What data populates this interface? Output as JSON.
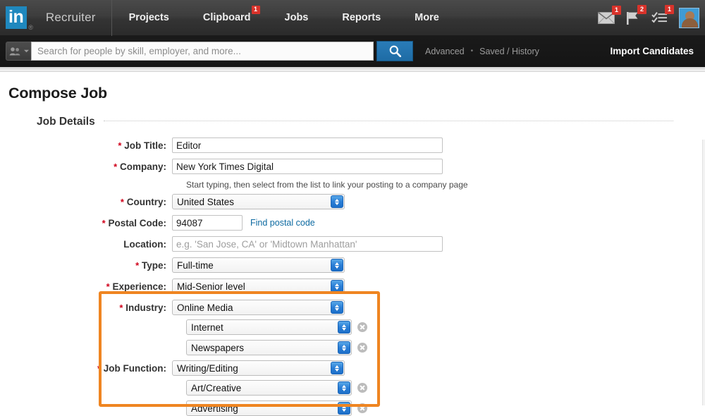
{
  "topnav": {
    "logo_text": "in",
    "logo_registered": "®",
    "brand": "Recruiter",
    "items": [
      {
        "label": "Projects",
        "badge": ""
      },
      {
        "label": "Clipboard",
        "badge": "1"
      },
      {
        "label": "Jobs",
        "badge": ""
      },
      {
        "label": "Reports",
        "badge": ""
      },
      {
        "label": "More",
        "badge": ""
      }
    ],
    "icons": [
      {
        "name": "messages-icon",
        "badge": "1"
      },
      {
        "name": "flag-icon",
        "badge": "2"
      },
      {
        "name": "tasks-icon",
        "badge": "1"
      }
    ]
  },
  "search": {
    "placeholder": "Search for people by skill, employer, and more...",
    "value": "",
    "advanced_label": "Advanced",
    "separator": "•",
    "saved_history_label": "Saved / History",
    "import_candidates_label": "Import Candidates"
  },
  "page": {
    "title": "Compose Job",
    "section_title": "Job Details"
  },
  "form": {
    "job_title": {
      "label": "Job Title:",
      "required": true,
      "value": "Editor"
    },
    "company": {
      "label": "Company:",
      "required": true,
      "value": "New York Times Digital",
      "help": "Start typing, then select from the list to link your posting to a company page"
    },
    "country": {
      "label": "Country:",
      "required": true,
      "value": "United States"
    },
    "postal_code": {
      "label": "Postal Code:",
      "required": true,
      "value": "94087",
      "link_label": "Find postal code"
    },
    "location": {
      "label": "Location:",
      "required": false,
      "value": "",
      "placeholder": "e.g. 'San Jose, CA' or 'Midtown Manhattan'"
    },
    "type": {
      "label": "Type:",
      "required": true,
      "value": "Full-time"
    },
    "experience": {
      "label": "Experience:",
      "required": true,
      "value": "Mid-Senior level"
    },
    "industry": {
      "label": "Industry:",
      "required": true,
      "values": [
        "Online Media",
        "Internet",
        "Newspapers"
      ]
    },
    "job_function": {
      "label": "Job Function:",
      "required": true,
      "values": [
        "Writing/Editing",
        "Art/Creative",
        "Advertising"
      ]
    }
  },
  "colors": {
    "highlight_orange": "#ef8521",
    "linkedin_blue": "#1f88be",
    "link_blue": "#0d6aa1",
    "badge_red": "#d9332b",
    "required_red": "#d0021b"
  }
}
